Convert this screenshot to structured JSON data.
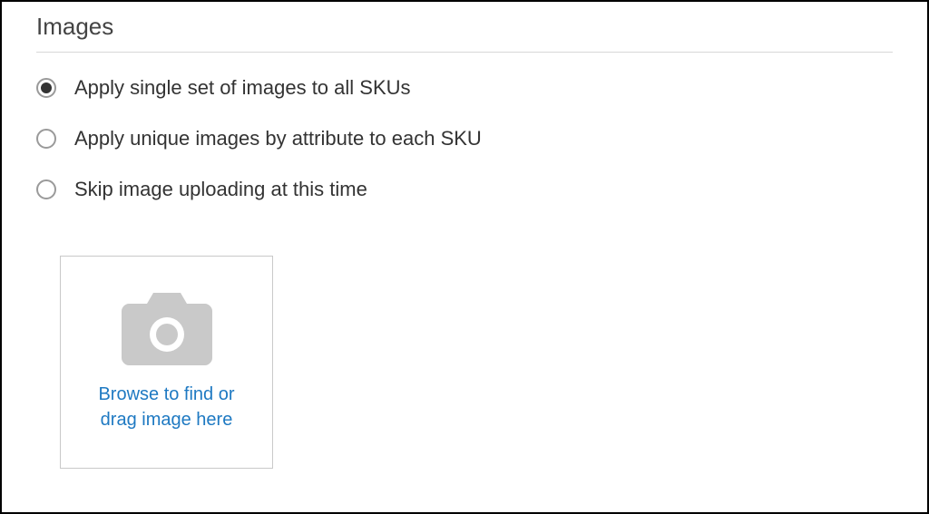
{
  "section": {
    "title": "Images"
  },
  "radio_options": {
    "option1": "Apply single set of images to all SKUs",
    "option2": "Apply unique images by attribute to each SKU",
    "option3": "Skip image uploading at this time"
  },
  "upload": {
    "prompt": "Browse to find or drag image here"
  }
}
